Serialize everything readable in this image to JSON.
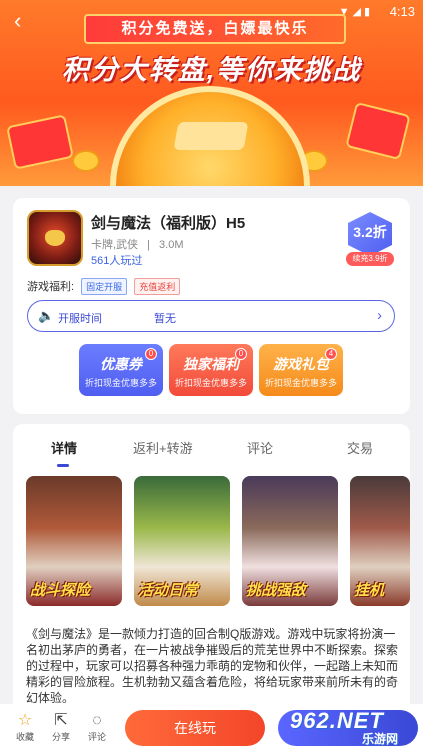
{
  "status_bar": {
    "time": "4:13"
  },
  "banner": {
    "ribbon_text": "积分免费送，白嫖最快乐",
    "headline": "积分大转盘,等你来挑战"
  },
  "app": {
    "title": "剑与魔法（福利版）H5",
    "genre": "卡牌,武侠",
    "size": "3.0M",
    "players": "561人玩过",
    "discount": "3.2折",
    "discount_sub": "续充3.9折",
    "welfare_label": "游戏福利:",
    "tags": [
      "固定开服",
      "充值返利"
    ],
    "open_time_label": "开服时间",
    "open_time_value": "暂无"
  },
  "promos": [
    {
      "title": "优惠券",
      "desc": "折扣现金优惠多多",
      "badge": "0"
    },
    {
      "title": "独家福利",
      "desc": "折扣现金优惠多多",
      "badge": "0"
    },
    {
      "title": "游戏礼包",
      "desc": "折扣现金优惠多多",
      "badge": "4"
    }
  ],
  "tabs": [
    "详情",
    "返利+转游",
    "评论",
    "交易"
  ],
  "screenshots": [
    {
      "caption": "战斗探险"
    },
    {
      "caption": "活动日常"
    },
    {
      "caption": "挑战强敌"
    },
    {
      "caption": "挂机"
    }
  ],
  "description": "《剑与魔法》是一款倾力打造的回合制Q版游戏。游戏中玩家将扮演一名初出茅庐的勇者，在一片被战争摧毁后的荒芜世界中不断探索。探索的过程中，玩家可以招募各种强力乖萌的宠物和伙伴，一起踏上未知而精彩的冒险旅程。生机勃勃又蕴含着危险，将给玩家带来前所未有的奇幻体验。",
  "bottom_bar": {
    "favorite": "收藏",
    "share": "分享",
    "comment": "评论",
    "play": "在线玩"
  },
  "watermark": {
    "logo": "962.NET",
    "sub": "乐游网"
  }
}
